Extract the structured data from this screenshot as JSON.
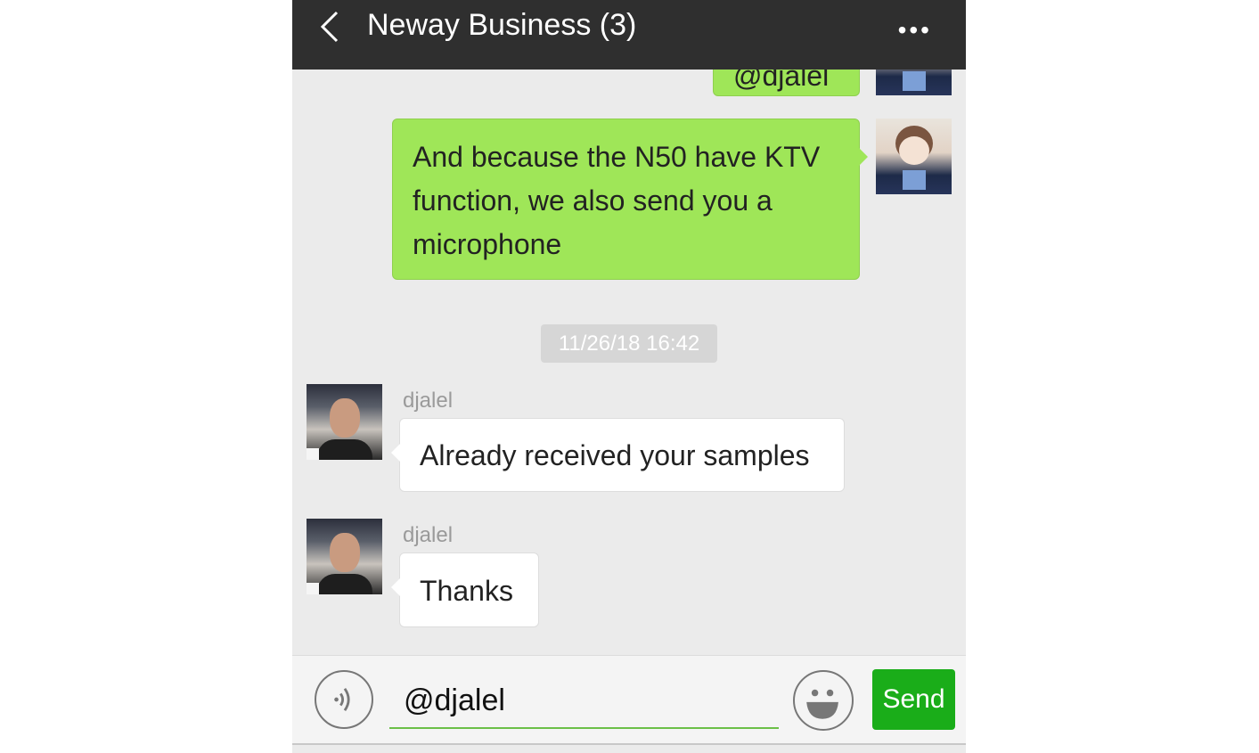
{
  "header": {
    "title": "Neway Business (3)",
    "back_icon": "chevron-left-icon",
    "more_icon": "more-dots-icon",
    "more_label": "•••"
  },
  "messages": [
    {
      "side": "right",
      "text": "@djalel"
    },
    {
      "side": "right",
      "text": "And because the N50 have KTV function, we also send you a microphone"
    },
    {
      "type": "timestamp",
      "text": "11/26/18 16:42"
    },
    {
      "side": "left",
      "sender": "djalel",
      "text": "Already received your samples"
    },
    {
      "side": "left",
      "sender": "djalel",
      "text": "Thanks"
    }
  ],
  "input": {
    "value": "@djalel",
    "send_label": "Send",
    "voice_icon": "voice-icon",
    "emoji_icon": "emoji-icon"
  },
  "colors": {
    "header": "#2f2f2f",
    "outgoing_bubble": "#9fe658",
    "send_button": "#1aad19",
    "background": "#ebebeb"
  }
}
